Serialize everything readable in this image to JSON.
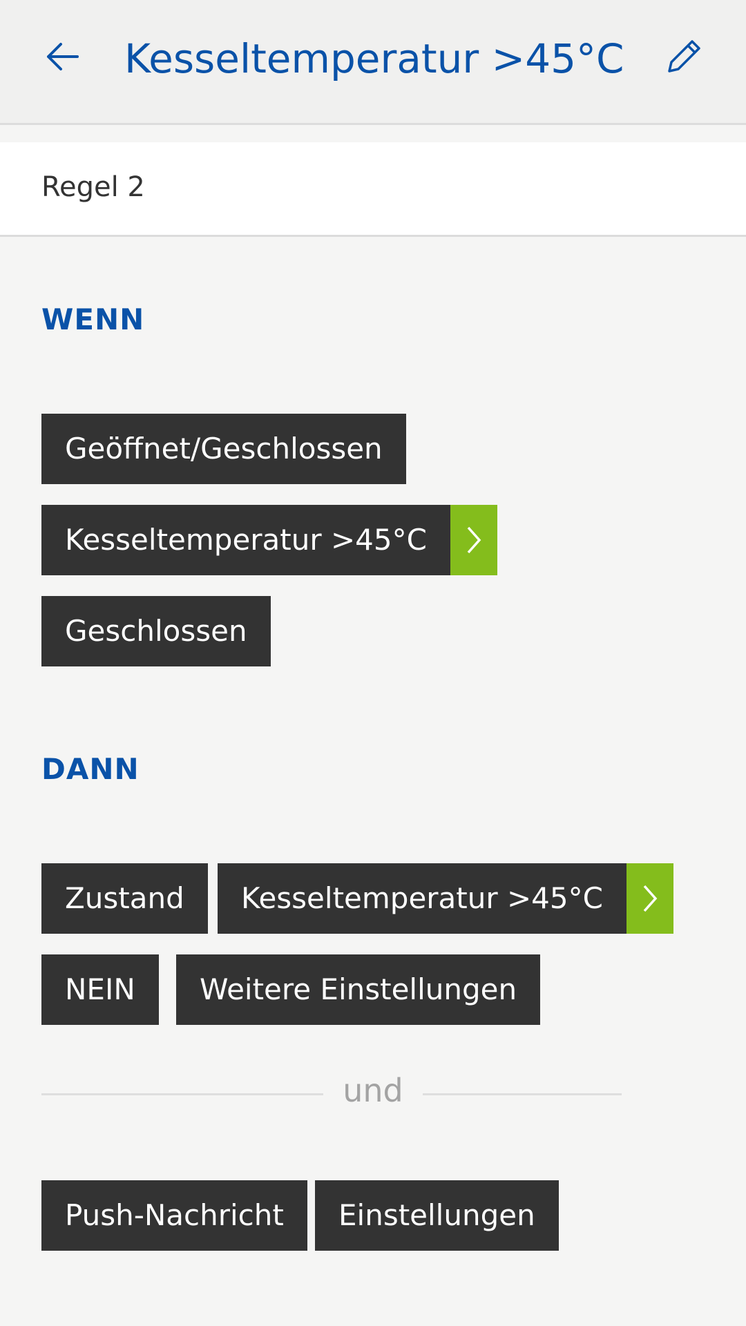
{
  "header": {
    "title": "Kesseltemperatur >45°C",
    "back_icon": "arrow-left-icon",
    "edit_icon": "pencil-icon"
  },
  "rule": {
    "name": "Regel 2"
  },
  "wenn": {
    "heading": "WENN",
    "chips": [
      {
        "label": "Geöffnet/Geschlossen"
      },
      {
        "label": "Kesseltemperatur >45°C",
        "has_arrow": true
      },
      {
        "label": "Geschlossen"
      }
    ]
  },
  "dann": {
    "heading": "DANN",
    "chips": [
      {
        "label": "Zustand"
      },
      {
        "label": "Kesseltemperatur >45°C",
        "has_arrow": true
      },
      {
        "label": "NEIN"
      },
      {
        "label": "Weitere Einstellungen"
      }
    ]
  },
  "separator": {
    "label": "und"
  },
  "actions": {
    "chips": [
      {
        "label": "Push-Nachricht"
      },
      {
        "label": "Einstellungen"
      }
    ]
  },
  "colors": {
    "accent": "#0a52a8",
    "chip_background": "#333333",
    "arrow_green": "#84bd1c",
    "page_background": "#f5f5f4"
  }
}
